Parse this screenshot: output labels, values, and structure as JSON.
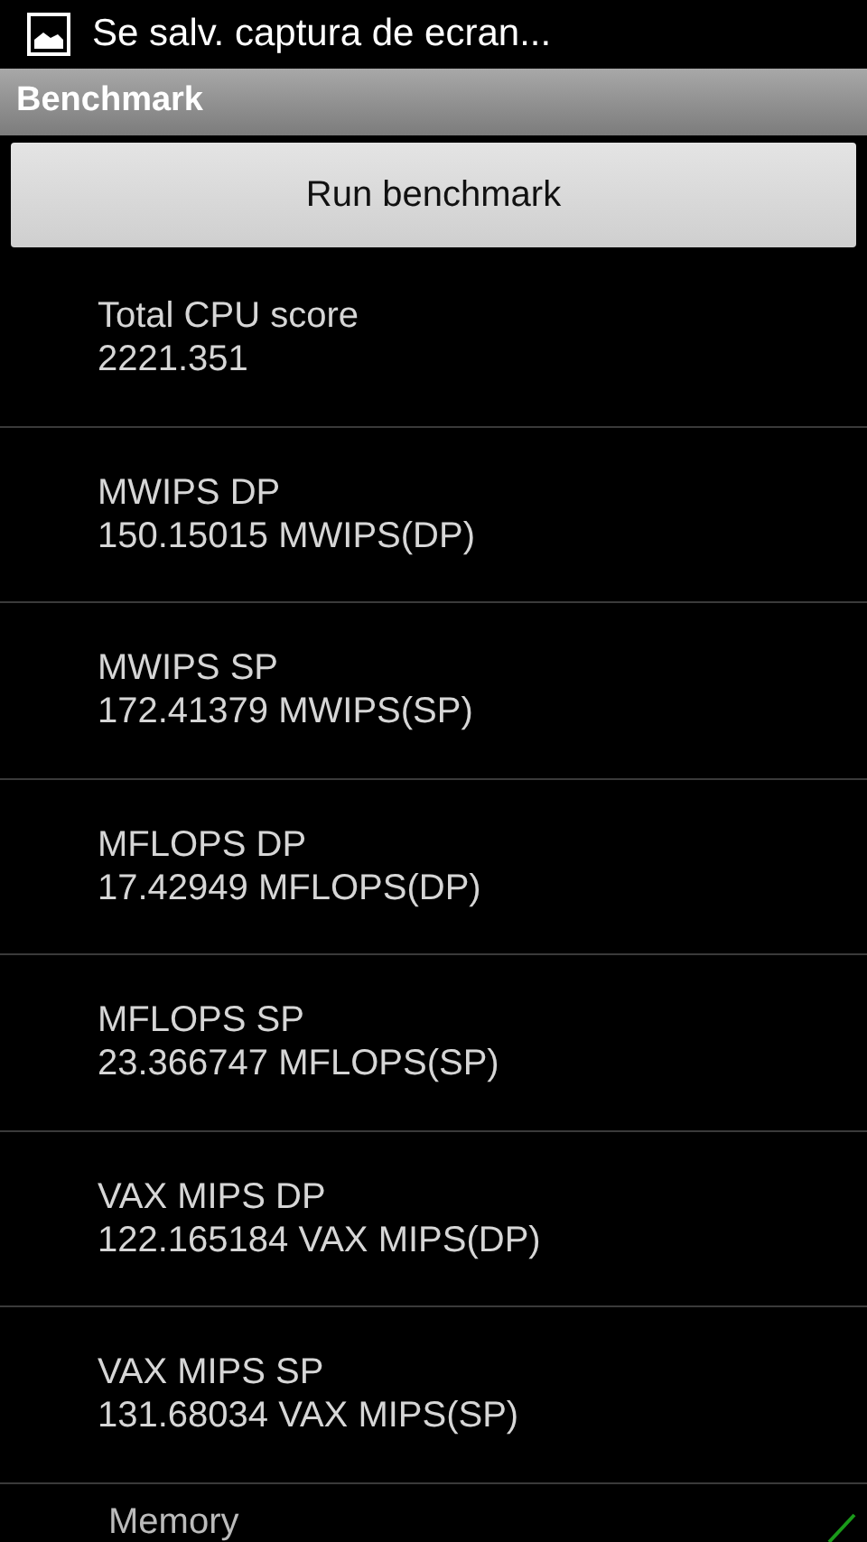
{
  "status_bar": {
    "notification": "Se salv. captura de ecran..."
  },
  "title_bar": {
    "title": "Benchmark"
  },
  "run_button": {
    "label": "Run benchmark"
  },
  "results": [
    {
      "label": "Total CPU score",
      "value": "2221.351"
    },
    {
      "label": "MWIPS DP",
      "value": "150.15015 MWIPS(DP)"
    },
    {
      "label": "MWIPS SP",
      "value": "172.41379 MWIPS(SP)"
    },
    {
      "label": "MFLOPS DP",
      "value": "17.42949 MFLOPS(DP)"
    },
    {
      "label": "MFLOPS SP",
      "value": "23.366747 MFLOPS(SP)"
    },
    {
      "label": "VAX MIPS DP",
      "value": "122.165184 VAX MIPS(DP)"
    },
    {
      "label": "VAX MIPS SP",
      "value": "131.68034 VAX MIPS(SP)"
    }
  ],
  "next_section": {
    "label": "Memory"
  }
}
